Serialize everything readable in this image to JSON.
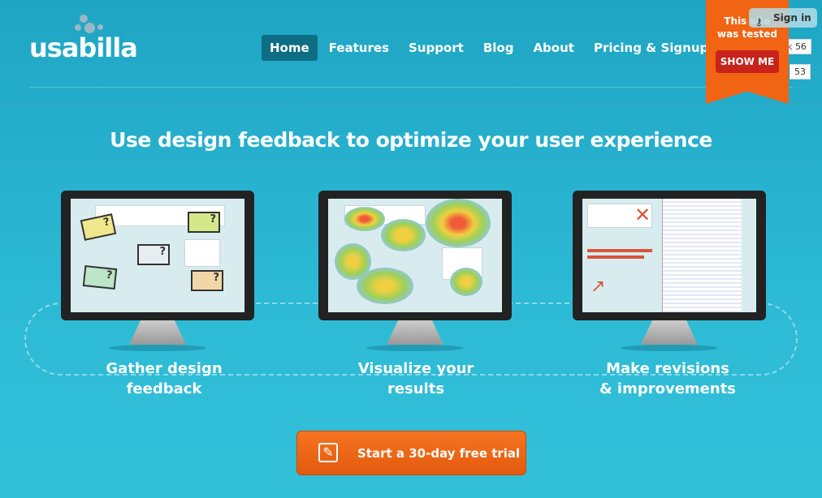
{
  "brand": {
    "name": "usabilla"
  },
  "nav": [
    {
      "label": "Home",
      "active": true
    },
    {
      "label": "Features"
    },
    {
      "label": "Support"
    },
    {
      "label": "Blog"
    },
    {
      "label": "About"
    },
    {
      "label": "Pricing & Signup"
    }
  ],
  "ribbon": {
    "line1": "This site",
    "line2": "was tested",
    "button": "SHOW ME",
    "color": "#f06414"
  },
  "signin": {
    "label": "Sign in",
    "icon": "key-icon"
  },
  "social": {
    "like_label": "lk",
    "like_count": "56",
    "share_count": "53"
  },
  "headline": "Use design feedback to optimize your user experience",
  "steps": [
    {
      "line1": "Gather design",
      "line2": "feedback"
    },
    {
      "line1": "Visualize your",
      "line2": "results"
    },
    {
      "line1": "Make revisions",
      "line2": "& improvements"
    }
  ],
  "cta": {
    "label": "Start a 30-day free trial",
    "icon": "pencil-icon",
    "color": "#f06414"
  }
}
